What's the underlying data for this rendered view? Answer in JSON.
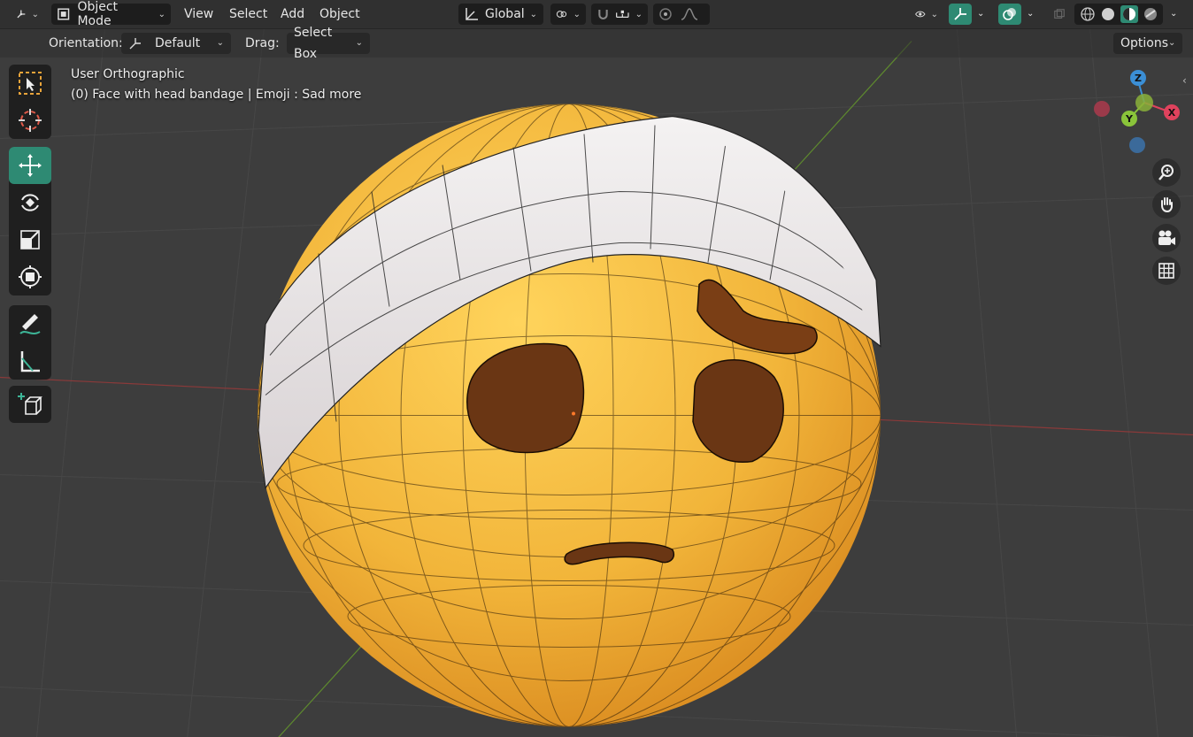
{
  "header": {
    "editor_type_icon": "orientation-gizmo-icon",
    "mode": {
      "icon": "object-mode-icon",
      "label": "Object Mode"
    },
    "menus": [
      "View",
      "Select",
      "Add",
      "Object"
    ],
    "transform_orientation": {
      "icon": "transform-axes-icon",
      "label": "Global"
    },
    "pivot_icon": "pivot-point-icon",
    "snap_icon": "magnet-icon",
    "snap_target_icon": "snap-increment-icon",
    "proportional_icon": "proportional-edit-icon",
    "falloff_icon": "falloff-curve-icon",
    "visibility_icon": "eye-icon",
    "gizmo_toggle_icon": "gizmo-icon",
    "overlay_toggle_icon": "overlays-icon",
    "xray_icon": "xray-icon",
    "shading_modes": [
      "wireframe",
      "solid",
      "material-preview",
      "rendered"
    ],
    "active_shading": "material-preview"
  },
  "subheader": {
    "orientation_label": "Orientation:",
    "orientation_value": "Default",
    "drag_label": "Drag:",
    "drag_value": "Select Box",
    "options_label": "Options"
  },
  "viewport": {
    "view_name": "User Orthographic",
    "object_info": "(0) Face with head bandage | Emoji : Sad more",
    "background_color": "#3d3d3d",
    "grid_line_color": "#474747",
    "x_axis_color": "#8a3a3a",
    "y_axis_color": "#5e8a2e"
  },
  "toolbar": {
    "groups": [
      [
        "select-box-icon",
        "cursor-icon"
      ],
      [
        "move-icon",
        "rotate-icon",
        "scale-icon",
        "transform-icon"
      ],
      [
        "annotate-icon",
        "measure-icon"
      ],
      [
        "add-cube-icon"
      ]
    ],
    "active_tool": "move-icon"
  },
  "nav_gizmo": {
    "axes": [
      "Z",
      "X",
      "Y"
    ],
    "x_color": "#e0425d",
    "y_color": "#8ac43a",
    "z_color": "#3b8fd6"
  },
  "nav_buttons": [
    "zoom-icon",
    "hand-pan-icon",
    "camera-icon",
    "grid-ortho-icon"
  ],
  "model": {
    "face_color": "#f0b43a",
    "bandage_color": "#eeeaea",
    "feature_color": "#6a3614"
  }
}
